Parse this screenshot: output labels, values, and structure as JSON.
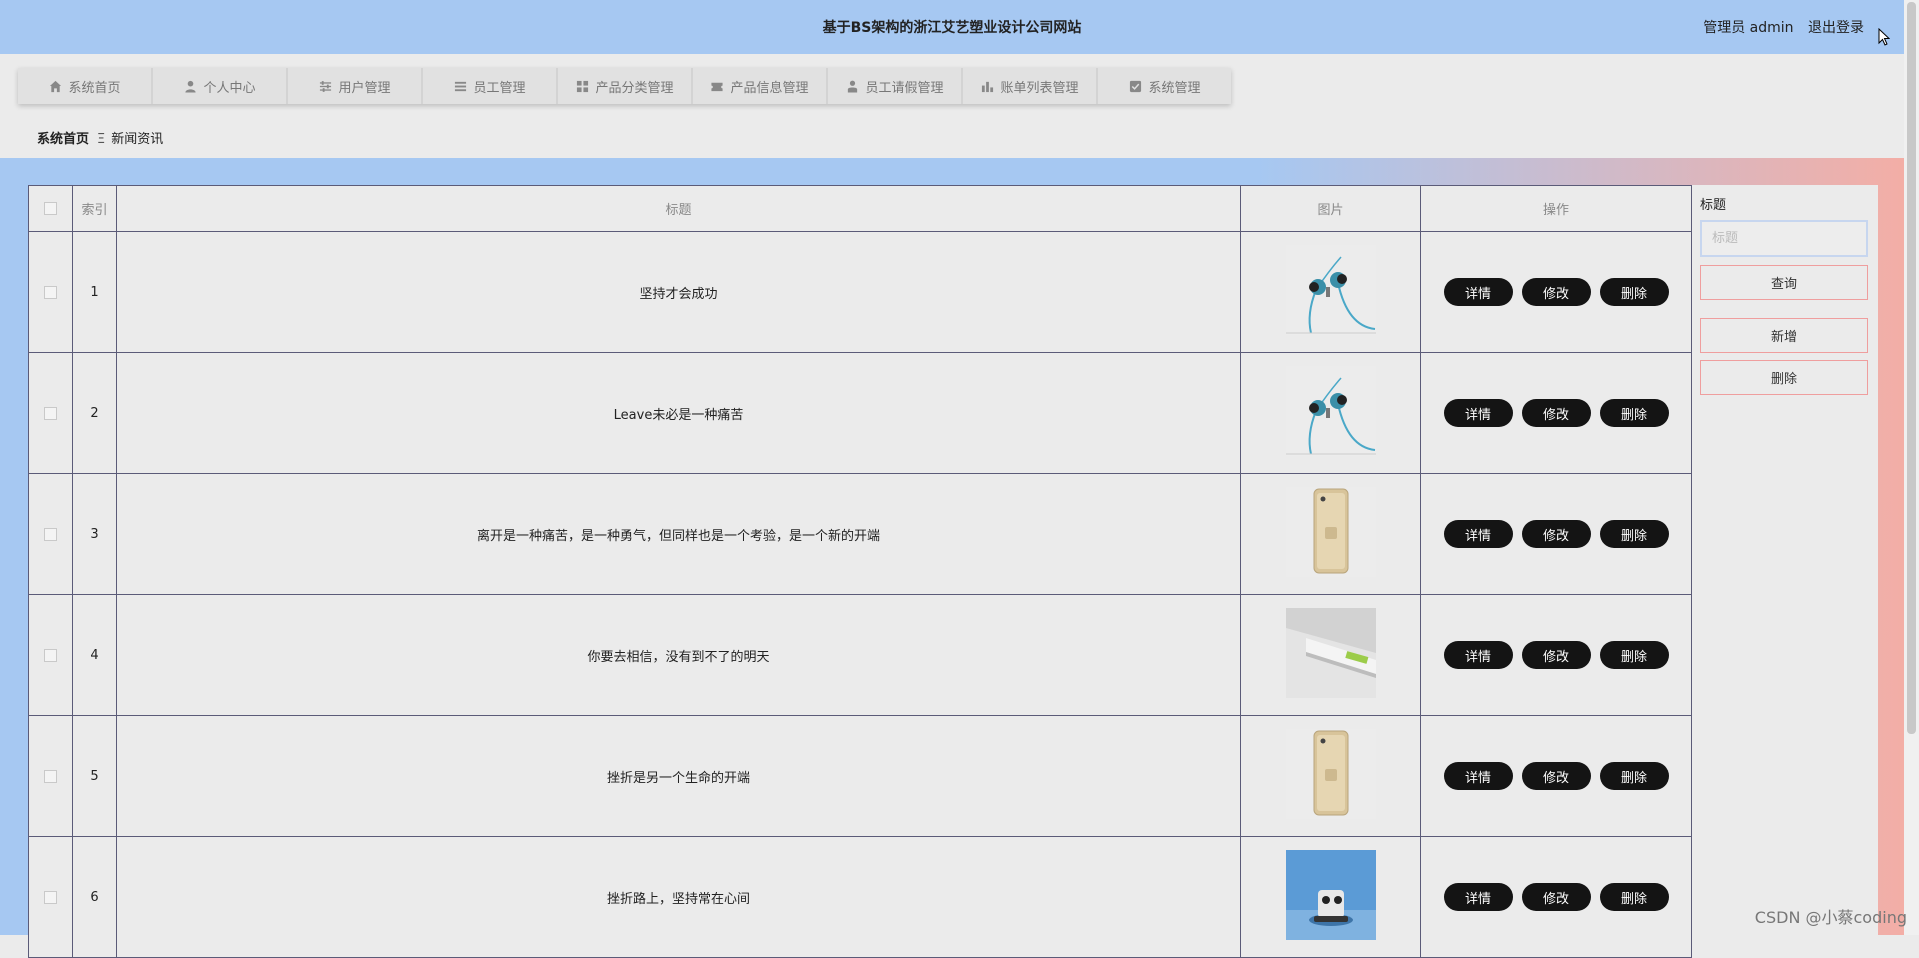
{
  "header": {
    "title": "基于BS架构的浙江艾艺塑业设计公司网站",
    "role_label": "管理员 admin",
    "logout_label": "退出登录"
  },
  "nav": [
    {
      "label": "系统首页",
      "icon": "home-icon"
    },
    {
      "label": "个人中心",
      "icon": "user-icon"
    },
    {
      "label": "用户管理",
      "icon": "sliders-icon"
    },
    {
      "label": "员工管理",
      "icon": "list-icon"
    },
    {
      "label": "产品分类管理",
      "icon": "grid-icon"
    },
    {
      "label": "产品信息管理",
      "icon": "ticket-icon"
    },
    {
      "label": "员工请假管理",
      "icon": "person-icon"
    },
    {
      "label": "账单列表管理",
      "icon": "bar-chart-icon"
    },
    {
      "label": "系统管理",
      "icon": "checkbox-icon"
    }
  ],
  "breadcrumb": {
    "home": "系统首页",
    "separator": "Ξ",
    "current": "新闻资讯"
  },
  "table": {
    "headers": [
      "索引",
      "标题",
      "图片",
      "操作"
    ],
    "rows": [
      {
        "index": "1",
        "title": "坚持才会成功",
        "image": "earphones"
      },
      {
        "index": "2",
        "title": "Leave未必是一种痛苦",
        "image": "earphones"
      },
      {
        "index": "3",
        "title": "离开是一种痛苦，是一种勇气，但同样也是一个考验，是一个新的开端",
        "image": "phone"
      },
      {
        "index": "4",
        "title": "你要去相信，没有到不了的明天",
        "image": "device"
      },
      {
        "index": "5",
        "title": "挫折是另一个生命的开端",
        "image": "phone"
      },
      {
        "index": "6",
        "title": "挫折路上，坚持常在心间",
        "image": "toy"
      }
    ],
    "actions": {
      "detail": "详情",
      "edit": "修改",
      "delete": "删除"
    }
  },
  "search": {
    "label": "标题",
    "placeholder": "标题",
    "query_label": "查询",
    "add_label": "新增",
    "delete_label": "删除"
  },
  "watermark": "CSDN @小蔡coding",
  "colors": {
    "header_bg": "#a6c8f2",
    "band_right": "#f3aea6",
    "button_dark": "#141414"
  }
}
